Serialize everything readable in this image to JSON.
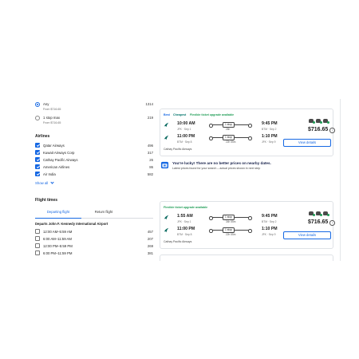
{
  "stops": [
    {
      "label": "Any",
      "price": "From $716.65",
      "count": "1314",
      "checked": true
    },
    {
      "label": "1 stop max",
      "price": "From $716.65",
      "count": "219",
      "checked": false
    }
  ],
  "airlines_heading": "Airlines",
  "airlines": [
    {
      "label": "Qatar Airways",
      "count": "496"
    },
    {
      "label": "Kuwait Airways Corp",
      "count": "317"
    },
    {
      "label": "Cathay Pacific Airways",
      "count": "26"
    },
    {
      "label": "American Airlines",
      "count": "86"
    },
    {
      "label": "Air India",
      "count": "582"
    }
  ],
  "show_all": "Show all",
  "flight_times_heading": "Flight times",
  "tabs": {
    "departing": "Departing flight",
    "return": "Return flight"
  },
  "departs_heading": "Departs John F. Kennedy International Airport",
  "time_ranges": [
    {
      "label": "12:00 AM–5:59 AM",
      "count": "457"
    },
    {
      "label": "6:00 AM–11:59 AM",
      "count": "207"
    },
    {
      "label": "12:00 PM–5:59 PM",
      "count": "269"
    },
    {
      "label": "6:00 PM–11:59 PM",
      "count": "381"
    }
  ],
  "results": [
    {
      "badges": [
        "Best",
        "Cheapest",
        "Flexible ticket upgrade available"
      ],
      "segments": [
        {
          "dep_time": "10:00 AM",
          "dep_sub": "JFK · Sep 1",
          "stops": "1 stop",
          "duration": "26h",
          "arr_time": "9:45 PM",
          "arr_sub": "BTM · Sep 2"
        },
        {
          "dep_time": "11:00 PM",
          "dep_sub": "BTM · Sep 8",
          "stops": "1 stop",
          "duration": "22h 55m",
          "arr_time": "1:10 PM",
          "arr_sub": "JFK · Sep 9"
        }
      ],
      "airline": "Cathay Pacific Airways",
      "price": "$716.65",
      "button": "View details"
    },
    {
      "badges": [
        "Flexible ticket upgrade available"
      ],
      "segments": [
        {
          "dep_time": "1:55 AM",
          "dep_sub": "JFK · Sep 1",
          "stops": "1 stop",
          "duration": "34h 55m",
          "arr_time": "9:45 PM",
          "arr_sub": "BTM · Sep 2"
        },
        {
          "dep_time": "11:00 PM",
          "dep_sub": "BTM · Sep 8",
          "stops": "1 stop",
          "duration": "22h 55m",
          "arr_time": "1:10 PM",
          "arr_sub": "JFK · Sep 9"
        }
      ],
      "airline": "Cathay Pacific Airways",
      "price": "$716.65",
      "button": "View details"
    }
  ],
  "lucky": {
    "title": "You're lucky! There are no better prices on nearby dates.",
    "desc": "Latest prices found for your search – actual prices shown in next step"
  },
  "colors": {
    "accent": "#1668e3",
    "green": "#1f9d55",
    "teal": "#00746b"
  }
}
